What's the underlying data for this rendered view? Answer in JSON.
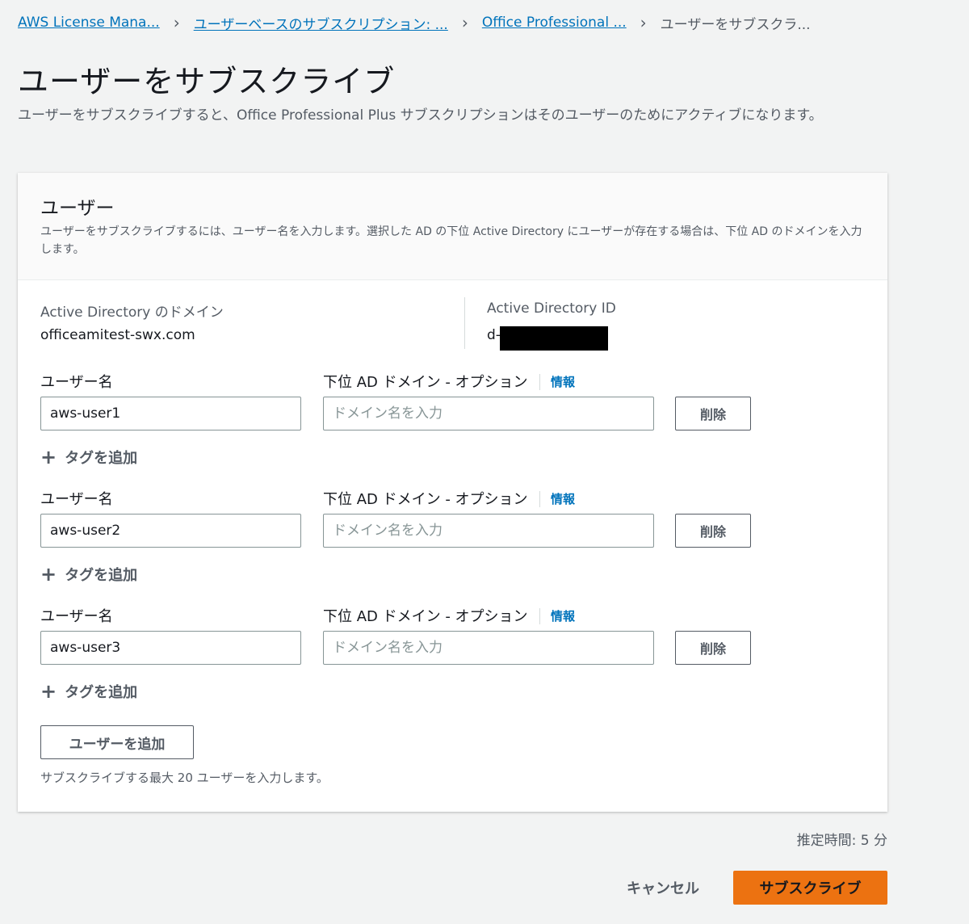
{
  "breadcrumb": {
    "items": [
      {
        "label": "AWS License Mana..."
      },
      {
        "label": "ユーザーベースのサブスクリプション: ..."
      },
      {
        "label": "Office Professional ..."
      }
    ],
    "current": "ユーザーをサブスクラ...",
    "separator": "›"
  },
  "page": {
    "title": "ユーザーをサブスクライブ",
    "description": "ユーザーをサブスクライブすると、Office Professional Plus サブスクリプションはそのユーザーのためにアクティブになります。"
  },
  "panel": {
    "title": "ユーザー",
    "description": "ユーザーをサブスクライブするには、ユーザー名を入力します。選択した AD の下位 Active Directory にユーザーが存在する場合は、下位 AD のドメインを入力します。",
    "ad_domain_label": "Active Directory のドメイン",
    "ad_domain_value": "officeamitest-swx.com",
    "ad_id_label": "Active Directory ID",
    "ad_id_value": "d-",
    "username_label": "ユーザー名",
    "subdomain_label": "下位 AD ドメイン - オプション",
    "info_label": "情報",
    "subdomain_placeholder": "ドメイン名を入力",
    "delete_label": "削除",
    "add_tag_label": "タグを追加",
    "users": [
      {
        "username": "aws-user1",
        "subdomain": ""
      },
      {
        "username": "aws-user2",
        "subdomain": ""
      },
      {
        "username": "aws-user3",
        "subdomain": ""
      }
    ],
    "add_user_label": "ユーザーを追加",
    "hint": "サブスクライブする最大 20 ユーザーを入力します。"
  },
  "footer": {
    "estimated_time": "推定時間: 5 分",
    "cancel_label": "キャンセル",
    "subscribe_label": "サブスクライブ"
  },
  "colors": {
    "link": "#0073bb",
    "primary_button": "#ec7211",
    "background": "#f2f3f3"
  },
  "icons": {
    "add_tag": "plus-icon",
    "breadcrumb_separator": "chevron-right-icon"
  }
}
